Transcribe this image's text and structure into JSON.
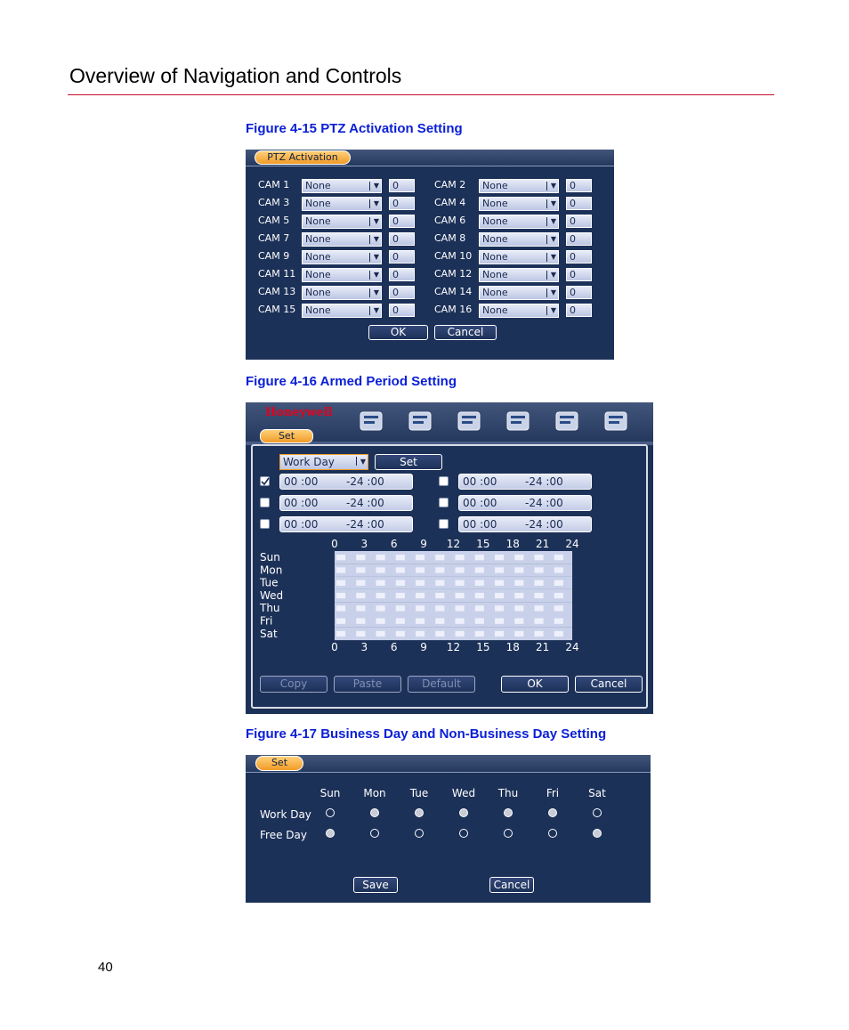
{
  "page": {
    "header": "Overview of Navigation and Controls",
    "page_number": "40"
  },
  "fig15": {
    "caption": "Figure 4-15 PTZ Activation Setting",
    "tab": "PTZ Activation",
    "rows": [
      {
        "left": {
          "cam": "CAM 1",
          "type": "None",
          "value": "0"
        },
        "right": {
          "cam": "CAM 2",
          "type": "None",
          "value": "0"
        }
      },
      {
        "left": {
          "cam": "CAM 3",
          "type": "None",
          "value": "0"
        },
        "right": {
          "cam": "CAM 4",
          "type": "None",
          "value": "0"
        }
      },
      {
        "left": {
          "cam": "CAM 5",
          "type": "None",
          "value": "0"
        },
        "right": {
          "cam": "CAM 6",
          "type": "None",
          "value": "0"
        }
      },
      {
        "left": {
          "cam": "CAM 7",
          "type": "None",
          "value": "0"
        },
        "right": {
          "cam": "CAM 8",
          "type": "None",
          "value": "0"
        }
      },
      {
        "left": {
          "cam": "CAM 9",
          "type": "None",
          "value": "0"
        },
        "right": {
          "cam": "CAM 10",
          "type": "None",
          "value": "0"
        }
      },
      {
        "left": {
          "cam": "CAM 11",
          "type": "None",
          "value": "0"
        },
        "right": {
          "cam": "CAM 12",
          "type": "None",
          "value": "0"
        }
      },
      {
        "left": {
          "cam": "CAM 13",
          "type": "None",
          "value": "0"
        },
        "right": {
          "cam": "CAM 14",
          "type": "None",
          "value": "0"
        }
      },
      {
        "left": {
          "cam": "CAM 15",
          "type": "None",
          "value": "0"
        },
        "right": {
          "cam": "CAM 16",
          "type": "None",
          "value": "0"
        }
      }
    ],
    "ok": "OK",
    "cancel": "Cancel"
  },
  "fig16": {
    "caption": "Figure 4-16 Armed Period Setting",
    "brand": "Honeywell",
    "tab": "Set",
    "day_select": "Work Day",
    "set_button": "Set",
    "periods": [
      {
        "checked": true,
        "start": "00 :00",
        "end": "-24 :00"
      },
      {
        "checked": false,
        "start": "00 :00",
        "end": "-24 :00"
      },
      {
        "checked": false,
        "start": "00 :00",
        "end": "-24 :00"
      },
      {
        "checked": false,
        "start": "00 :00",
        "end": "-24 :00"
      },
      {
        "checked": false,
        "start": "00 :00",
        "end": "-24 :00"
      },
      {
        "checked": false,
        "start": "00 :00",
        "end": "-24 :00"
      }
    ],
    "days": [
      "Sun",
      "Mon",
      "Tue",
      "Wed",
      "Thu",
      "Fri",
      "Sat"
    ],
    "hours": [
      "0",
      "3",
      "6",
      "9",
      "12",
      "15",
      "18",
      "21",
      "24"
    ],
    "buttons": {
      "copy": "Copy",
      "paste": "Paste",
      "default": "Default",
      "ok": "OK",
      "cancel": "Cancel"
    },
    "icons": [
      "search-icon",
      "book-icon",
      "tools-icon",
      "checklist-icon",
      "disk-icon",
      "shutdown-icon"
    ]
  },
  "fig17": {
    "caption": "Figure 4-17 Business Day and Non-Business Day Setting",
    "tab": "Set",
    "days": [
      "Sun",
      "Mon",
      "Tue",
      "Wed",
      "Thu",
      "Fri",
      "Sat"
    ],
    "work_label": "Work Day",
    "free_label": "Free Day",
    "work": [
      false,
      true,
      true,
      true,
      true,
      true,
      false
    ],
    "free": [
      true,
      false,
      false,
      false,
      false,
      false,
      true
    ],
    "save": "Save",
    "cancel": "Cancel"
  },
  "colors": {
    "caption": "#0a1fd6",
    "rule": "#c8102e",
    "panel": "#1c3158",
    "tab": "#f19b27",
    "brand": "#e4001b"
  }
}
